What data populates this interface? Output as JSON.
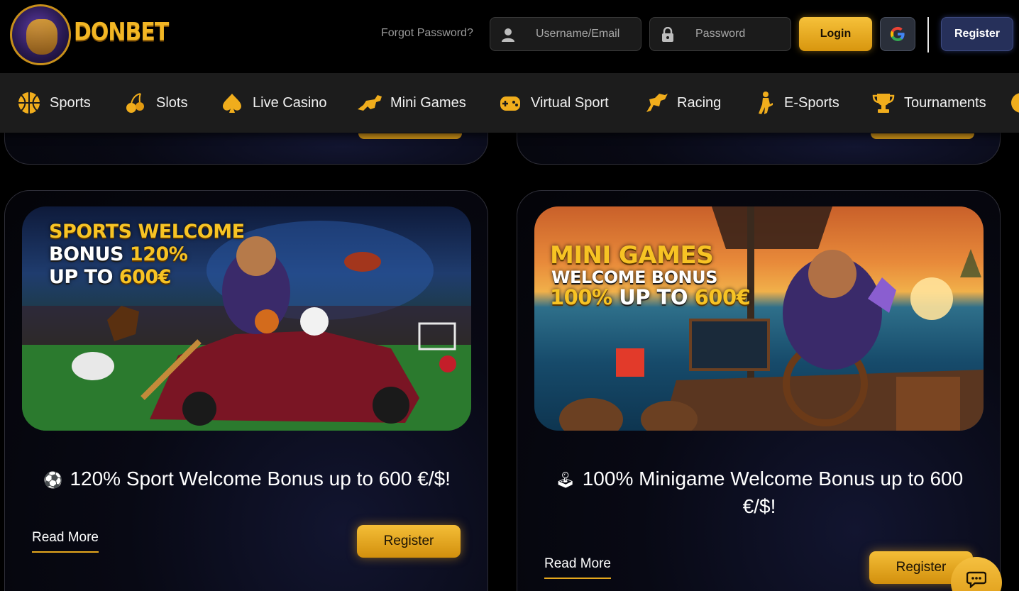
{
  "header": {
    "logo_text": "DONBET",
    "forgot_password": "Forgot Password?",
    "username_placeholder": "Username/Email",
    "password_placeholder": "Password",
    "login_label": "Login",
    "register_label": "Register"
  },
  "nav": {
    "items": [
      {
        "label": "Sports",
        "icon": "basketball-icon"
      },
      {
        "label": "Slots",
        "icon": "cherry-icon"
      },
      {
        "label": "Live Casino",
        "icon": "spade-icon"
      },
      {
        "label": "Mini Games",
        "icon": "dino-icon"
      },
      {
        "label": "Virtual Sport",
        "icon": "gamepad-icon"
      },
      {
        "label": "Racing",
        "icon": "horse-icon"
      },
      {
        "label": "E-Sports",
        "icon": "soldier-icon"
      },
      {
        "label": "Tournaments",
        "icon": "trophy-icon"
      }
    ]
  },
  "promos": [
    {
      "banner_line1": "SPORTS WELCOME",
      "banner_line2a": "BONUS ",
      "banner_line2b": "120%",
      "banner_line3a": "UP TO ",
      "banner_line3b": "600€",
      "emoji": "⚽",
      "title": "120% Sport Welcome Bonus up to 600 €/$!",
      "read_more": "Read More",
      "register": "Register"
    },
    {
      "banner_line1": "MINI GAMES",
      "banner_line2": "WELCOME BONUS",
      "banner_line3a": "100% ",
      "banner_line3b": "UP TO ",
      "banner_line3c": "600€",
      "emoji": "🕹",
      "title_line1": "100% Minigame Welcome Bonus up to 600",
      "title_line2": "€/$!",
      "read_more": "Read More",
      "register": "Register"
    }
  ],
  "colors": {
    "accent": "#f2b624",
    "background": "#000000",
    "nav_bg": "#1c1c1c",
    "register_top_bg": "#26305a"
  }
}
